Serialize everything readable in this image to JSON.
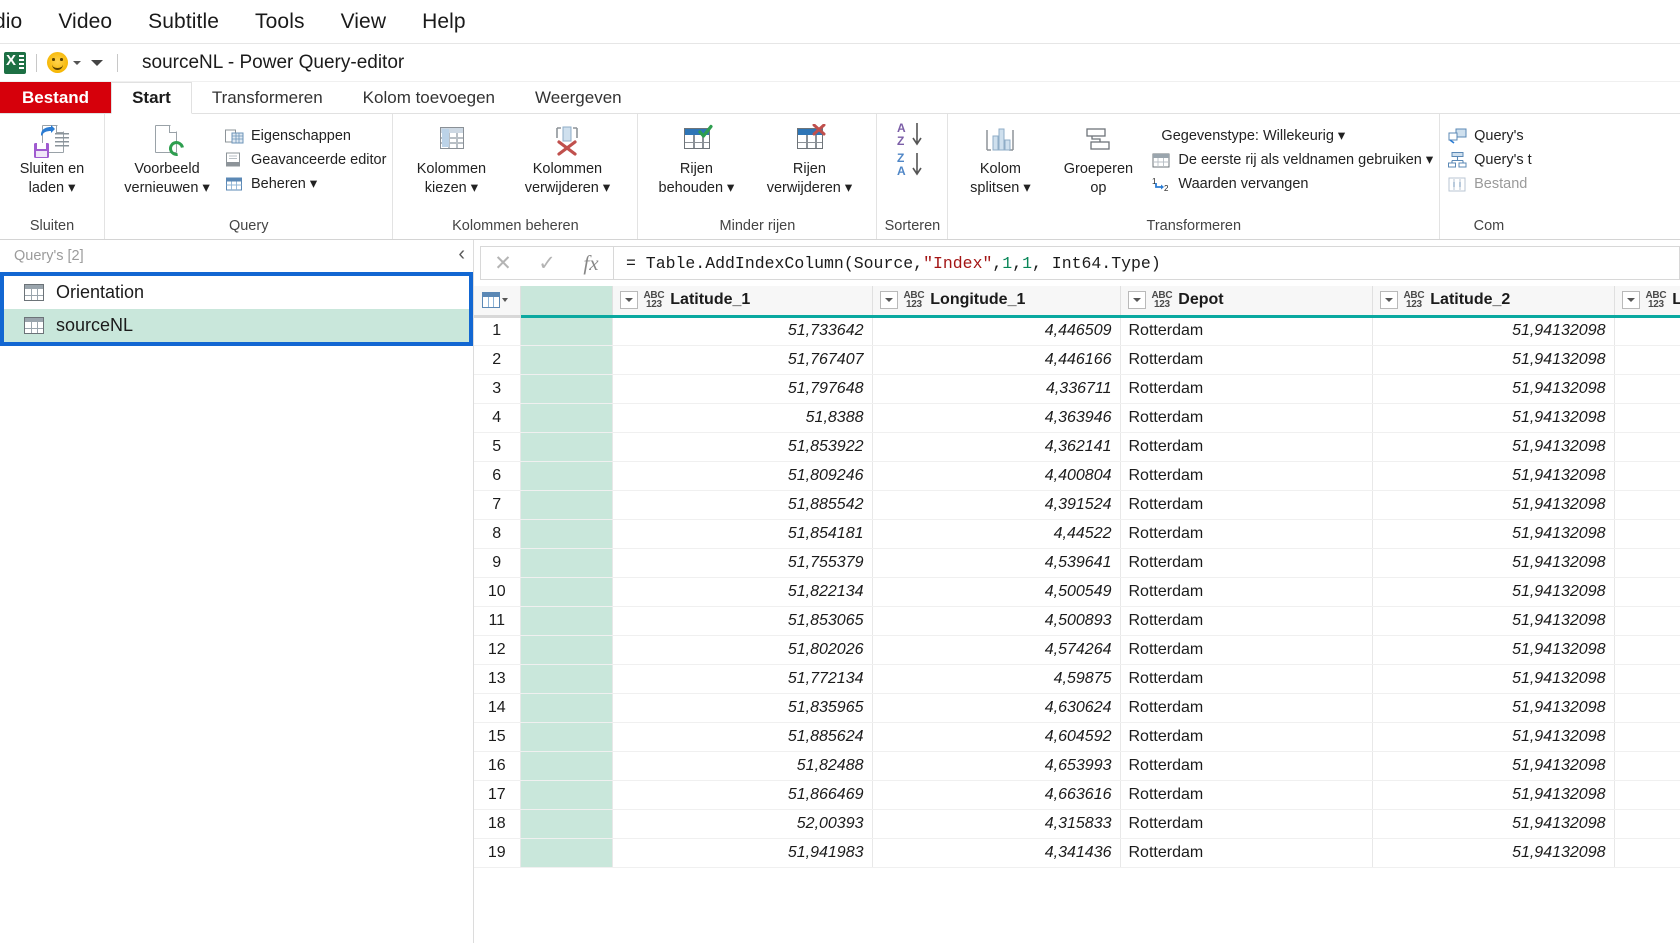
{
  "host_menu": [
    "dio",
    "Video",
    "Subtitle",
    "Tools",
    "View",
    "Help"
  ],
  "titlebar": {
    "title": "sourceNL - Power Query-editor"
  },
  "ribbon_tabs": [
    {
      "label": "Bestand",
      "kind": "file"
    },
    {
      "label": "Start",
      "kind": "active"
    },
    {
      "label": "Transformeren",
      "kind": "normal"
    },
    {
      "label": "Kolom toevoegen",
      "kind": "normal"
    },
    {
      "label": "Weergeven",
      "kind": "normal"
    }
  ],
  "ribbon": {
    "groups": [
      {
        "label": "Sluiten",
        "big": [
          {
            "label1": "Sluiten en",
            "label2": "laden ▾",
            "icon": "save-load-icon"
          }
        ],
        "small": []
      },
      {
        "label": "Query",
        "big": [
          {
            "label1": "Voorbeeld",
            "label2": "vernieuwen ▾",
            "icon": "refresh-preview-icon"
          }
        ],
        "small": [
          {
            "label": "Eigenschappen",
            "icon": "properties-icon"
          },
          {
            "label": "Geavanceerde editor",
            "icon": "advanced-editor-icon"
          },
          {
            "label": "Beheren ▾",
            "icon": "manage-icon"
          }
        ]
      },
      {
        "label": "Kolommen beheren",
        "big": [
          {
            "label1": "Kolommen",
            "label2": "kiezen ▾",
            "icon": "choose-columns-icon"
          },
          {
            "label1": "Kolommen",
            "label2": "verwijderen ▾",
            "icon": "remove-columns-icon"
          }
        ],
        "small": []
      },
      {
        "label": "Minder rijen",
        "big": [
          {
            "label1": "Rijen",
            "label2": "behouden ▾",
            "icon": "keep-rows-icon"
          },
          {
            "label1": "Rijen",
            "label2": "verwijderen ▾",
            "icon": "remove-rows-icon"
          }
        ],
        "small": []
      },
      {
        "label": "Sorteren",
        "big": [],
        "small": [
          {
            "label": "",
            "icon": "sort-ascending-icon"
          },
          {
            "label": "",
            "icon": "sort-descending-icon"
          }
        ]
      },
      {
        "label": "Transformeren",
        "big": [
          {
            "label1": "Kolom",
            "label2": "splitsen ▾",
            "icon": "split-column-icon"
          },
          {
            "label1": "Groeperen",
            "label2": "op",
            "icon": "group-by-icon"
          }
        ],
        "small": [
          {
            "label": "Gegevenstype: Willekeurig ▾",
            "icon": "data-type-icon"
          },
          {
            "label": "De eerste rij als veldnamen gebruiken ▾",
            "icon": "first-row-headers-icon"
          },
          {
            "label": "Waarden vervangen",
            "icon": "replace-values-icon"
          }
        ]
      },
      {
        "label": "Com",
        "big": [],
        "small": [
          {
            "label": "Query's",
            "icon": "merge-queries-icon",
            "dim": false
          },
          {
            "label": "Query's t",
            "icon": "append-queries-icon",
            "dim": false
          },
          {
            "label": "Bestand",
            "icon": "combine-files-icon",
            "dim": true
          }
        ]
      }
    ]
  },
  "queries_pane": {
    "title": "Query's [2]",
    "collapse_glyph": "‹",
    "items": [
      {
        "label": "Orientation",
        "selected": false
      },
      {
        "label": "sourceNL",
        "selected": true
      }
    ]
  },
  "formula_bar": {
    "cancel_glyph": "✕",
    "confirm_glyph": "✓",
    "fx_glyph": "fx",
    "formula_prefix": "= Table.AddIndexColumn(Source, ",
    "formula_string": "\"Index\"",
    "formula_mid1": ", ",
    "formula_num1": "1",
    "formula_mid2": ", ",
    "formula_num2": "1",
    "formula_suffix": ", Int64.Type)"
  },
  "table": {
    "type_glyph_top": "ABC",
    "type_glyph_bottom": "123",
    "columns": [
      {
        "name": "Latitude_1",
        "type": "ABC123",
        "align": "num"
      },
      {
        "name": "Longitude_1",
        "type": "ABC123",
        "align": "num"
      },
      {
        "name": "Depot",
        "type": "ABC123",
        "align": "txt"
      },
      {
        "name": "Latitude_2",
        "type": "ABC123",
        "align": "num"
      },
      {
        "name": "Lo",
        "type": "ABC123",
        "align": "num"
      }
    ],
    "rows": [
      {
        "n": "1",
        "Latitude_1": "51,733642",
        "Longitude_1": "4,446509",
        "Depot": "Rotterdam",
        "Latitude_2": "51,94132098",
        "Lo": ""
      },
      {
        "n": "2",
        "Latitude_1": "51,767407",
        "Longitude_1": "4,446166",
        "Depot": "Rotterdam",
        "Latitude_2": "51,94132098",
        "Lo": ""
      },
      {
        "n": "3",
        "Latitude_1": "51,797648",
        "Longitude_1": "4,336711",
        "Depot": "Rotterdam",
        "Latitude_2": "51,94132098",
        "Lo": ""
      },
      {
        "n": "4",
        "Latitude_1": "51,8388",
        "Longitude_1": "4,363946",
        "Depot": "Rotterdam",
        "Latitude_2": "51,94132098",
        "Lo": ""
      },
      {
        "n": "5",
        "Latitude_1": "51,853922",
        "Longitude_1": "4,362141",
        "Depot": "Rotterdam",
        "Latitude_2": "51,94132098",
        "Lo": ""
      },
      {
        "n": "6",
        "Latitude_1": "51,809246",
        "Longitude_1": "4,400804",
        "Depot": "Rotterdam",
        "Latitude_2": "51,94132098",
        "Lo": ""
      },
      {
        "n": "7",
        "Latitude_1": "51,885542",
        "Longitude_1": "4,391524",
        "Depot": "Rotterdam",
        "Latitude_2": "51,94132098",
        "Lo": ""
      },
      {
        "n": "8",
        "Latitude_1": "51,854181",
        "Longitude_1": "4,44522",
        "Depot": "Rotterdam",
        "Latitude_2": "51,94132098",
        "Lo": ""
      },
      {
        "n": "9",
        "Latitude_1": "51,755379",
        "Longitude_1": "4,539641",
        "Depot": "Rotterdam",
        "Latitude_2": "51,94132098",
        "Lo": ""
      },
      {
        "n": "10",
        "Latitude_1": "51,822134",
        "Longitude_1": "4,500549",
        "Depot": "Rotterdam",
        "Latitude_2": "51,94132098",
        "Lo": ""
      },
      {
        "n": "11",
        "Latitude_1": "51,853065",
        "Longitude_1": "4,500893",
        "Depot": "Rotterdam",
        "Latitude_2": "51,94132098",
        "Lo": ""
      },
      {
        "n": "12",
        "Latitude_1": "51,802026",
        "Longitude_1": "4,574264",
        "Depot": "Rotterdam",
        "Latitude_2": "51,94132098",
        "Lo": ""
      },
      {
        "n": "13",
        "Latitude_1": "51,772134",
        "Longitude_1": "4,59875",
        "Depot": "Rotterdam",
        "Latitude_2": "51,94132098",
        "Lo": ""
      },
      {
        "n": "14",
        "Latitude_1": "51,835965",
        "Longitude_1": "4,630624",
        "Depot": "Rotterdam",
        "Latitude_2": "51,94132098",
        "Lo": ""
      },
      {
        "n": "15",
        "Latitude_1": "51,885624",
        "Longitude_1": "4,604592",
        "Depot": "Rotterdam",
        "Latitude_2": "51,94132098",
        "Lo": ""
      },
      {
        "n": "16",
        "Latitude_1": "51,82488",
        "Longitude_1": "4,653993",
        "Depot": "Rotterdam",
        "Latitude_2": "51,94132098",
        "Lo": ""
      },
      {
        "n": "17",
        "Latitude_1": "51,866469",
        "Longitude_1": "4,663616",
        "Depot": "Rotterdam",
        "Latitude_2": "51,94132098",
        "Lo": ""
      },
      {
        "n": "18",
        "Latitude_1": "52,00393",
        "Longitude_1": "4,315833",
        "Depot": "Rotterdam",
        "Latitude_2": "51,94132098",
        "Lo": ""
      },
      {
        "n": "19",
        "Latitude_1": "51,941983",
        "Longitude_1": "4,341436",
        "Depot": "Rotterdam",
        "Latitude_2": "51,94132098",
        "Lo": ""
      }
    ]
  },
  "colors": {
    "file_tab_red": "#d6000b",
    "selection_blue": "#1267d2",
    "selected_row_green": "#c9e7db",
    "header_underline_teal": "#0aa9a0"
  }
}
